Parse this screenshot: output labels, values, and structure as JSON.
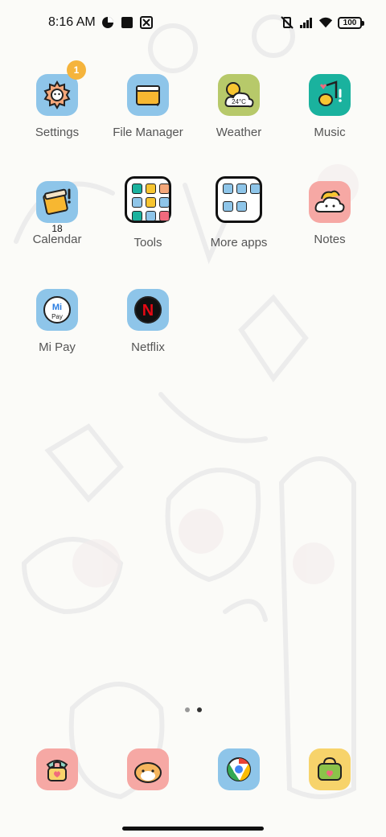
{
  "statusbar": {
    "time": "8:16 AM",
    "battery": "100"
  },
  "apps": {
    "settings": {
      "label": "Settings",
      "badge": "1"
    },
    "file_manager": {
      "label": "File Manager"
    },
    "weather": {
      "label": "Weather",
      "temp": "24°C"
    },
    "music": {
      "label": "Music"
    },
    "calendar": {
      "label": "Calendar",
      "date": "18"
    },
    "tools": {
      "label": "Tools"
    },
    "more_apps": {
      "label": "More apps"
    },
    "notes": {
      "label": "Notes"
    },
    "mi_pay": {
      "label": "Mi Pay",
      "logo_text": "Mi",
      "logo_sub": "Pay"
    },
    "netflix": {
      "label": "Netflix",
      "logo_text": "N"
    }
  },
  "page_indicator": {
    "pages": 2,
    "active": 2
  },
  "icons": {
    "settings": "gear-icon",
    "file_manager": "folder-icon",
    "weather": "sun-cloud-icon",
    "music": "music-note-icon",
    "calendar": "calendar-icon",
    "notes": "notes-cloud-icon",
    "mi_pay": "mi-pay-icon",
    "netflix": "netflix-icon",
    "dock_phone": "phone-icon",
    "dock_messages": "hamster-icon",
    "dock_browser": "chrome-icon",
    "dock_camera": "camera-bag-icon"
  },
  "colors": {
    "icon_bg_blue": "#8ec5e9",
    "badge": "#f5b43c",
    "netflix_red": "#e50914"
  }
}
